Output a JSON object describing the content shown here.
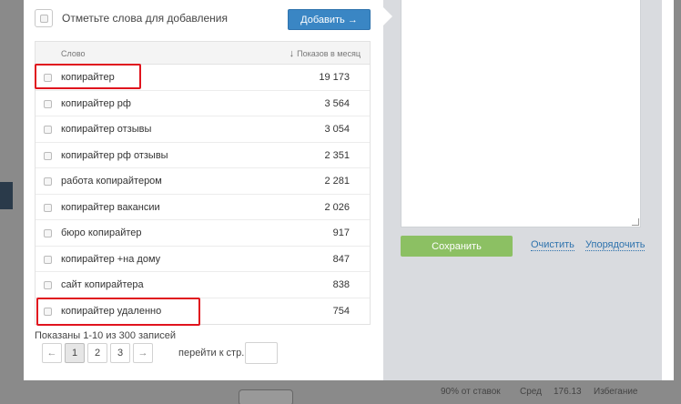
{
  "header": {
    "select_all_label": "Отметьте слова для добавления",
    "add_button": "Добавить →"
  },
  "table": {
    "col_word": "Слово",
    "col_shows": "Показов в месяц",
    "rows": [
      {
        "word": "копирайтер",
        "count": "19 173"
      },
      {
        "word": "копирайтер рф",
        "count": "3 564"
      },
      {
        "word": "копирайтер отзывы",
        "count": "3 054"
      },
      {
        "word": "копирайтер рф отзывы",
        "count": "2 351"
      },
      {
        "word": "работа копирайтером",
        "count": "2 281"
      },
      {
        "word": "копирайтер вакансии",
        "count": "2 026"
      },
      {
        "word": "бюро копирайтер",
        "count": "917"
      },
      {
        "word": "копирайтер +на дому",
        "count": "847"
      },
      {
        "word": "сайт копирайтера",
        "count": "838"
      },
      {
        "word": "копирайтер удаленно",
        "count": "754"
      }
    ]
  },
  "pager": {
    "info": "Показаны 1-10 из 300 записей",
    "prev": "←",
    "pages": [
      "1",
      "2",
      "3"
    ],
    "next": "→",
    "goto_label": "перейти к стр."
  },
  "right": {
    "save_button": "Сохранить",
    "clear_link": "Очистить",
    "sort_link": "Упорядочить"
  },
  "background": {
    "bottom_text_1": "90% от ставок",
    "bottom_text_2": "Сред",
    "bottom_text_3": "176.13",
    "bottom_text_4": "Избегание"
  }
}
